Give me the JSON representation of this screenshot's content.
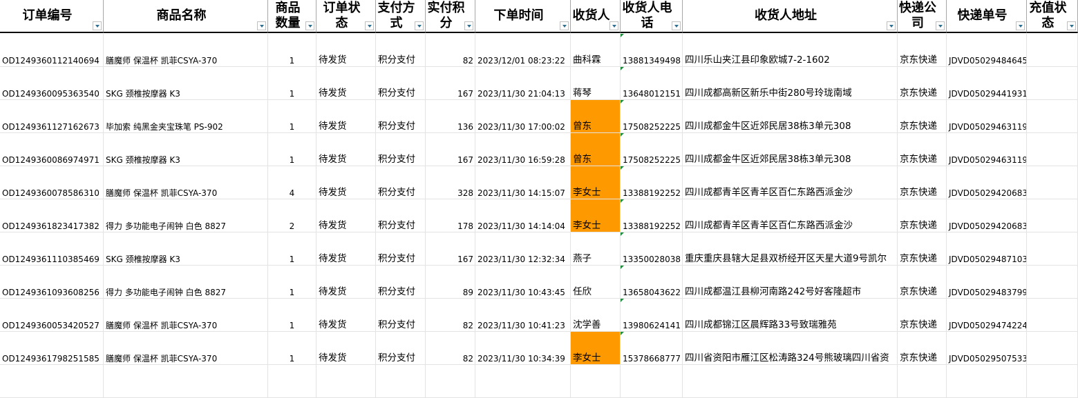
{
  "headers": [
    "订单编号",
    "商品名称",
    "商品数量",
    "订单状态",
    "支付方式",
    "实付积分",
    "下单时间",
    "收货人",
    "收货人电话",
    "收货人地址",
    "快递公司",
    "快递单号",
    "充值状态"
  ],
  "rows": [
    {
      "order_id": "OD1249360112140694",
      "product": "膳魔师 保温杯 凯菲CSYA-370",
      "qty": "1",
      "status": "待发货",
      "pay": "积分支付",
      "points": "82",
      "time": "2023/12/01 08:23:22",
      "recipient": "曲科霖",
      "recipient_highlight": false,
      "phone": "13881349498",
      "address": "四川乐山夹江县印象欧城7-2-1602",
      "courier": "京东快递",
      "tracking": "JDVD05029484645",
      "recharge": ""
    },
    {
      "order_id": "OD1249360095363540",
      "product": "SKG 颈椎按摩器 K3",
      "qty": "1",
      "status": "待发货",
      "pay": "积分支付",
      "points": "167",
      "time": "2023/11/30 21:04:13",
      "recipient": "蒋琴",
      "recipient_highlight": false,
      "phone": "13648012151",
      "address": "四川成都高新区新乐中街280号玲珑南域",
      "courier": "京东快递",
      "tracking": "JDVD05029441931",
      "recharge": ""
    },
    {
      "order_id": "OD1249361127162673",
      "product": "毕加索 纯黑金夹宝珠笔 PS-902",
      "qty": "1",
      "status": "待发货",
      "pay": "积分支付",
      "points": "136",
      "time": "2023/11/30 17:00:02",
      "recipient": "曾东",
      "recipient_highlight": true,
      "phone": "17508252225",
      "address": "四川成都金牛区近郊民居38栋3单元308",
      "courier": "京东快递",
      "tracking": "JDVD05029463119",
      "recharge": ""
    },
    {
      "order_id": "OD1249360086974971",
      "product": "SKG 颈椎按摩器 K3",
      "qty": "1",
      "status": "待发货",
      "pay": "积分支付",
      "points": "167",
      "time": "2023/11/30 16:59:28",
      "recipient": "曾东",
      "recipient_highlight": true,
      "phone": "17508252225",
      "address": "四川成都金牛区近郊民居38栋3单元308",
      "courier": "京东快递",
      "tracking": "JDVD05029463119",
      "recharge": ""
    },
    {
      "order_id": "OD1249360078586310",
      "product": "膳魔师 保温杯 凯菲CSYA-370",
      "qty": "4",
      "status": "待发货",
      "pay": "积分支付",
      "points": "328",
      "time": "2023/11/30 14:15:07",
      "recipient": "李女士",
      "recipient_highlight": true,
      "phone": "13388192252",
      "address": "四川成都青羊区青羊区百仁东路西派金沙",
      "courier": "京东快递",
      "tracking": "JDVD05029420683",
      "recharge": ""
    },
    {
      "order_id": "OD1249361823417382",
      "product": "得力 多功能电子闹钟 白色 8827",
      "qty": "2",
      "status": "待发货",
      "pay": "积分支付",
      "points": "178",
      "time": "2023/11/30 14:14:04",
      "recipient": "李女士",
      "recipient_highlight": true,
      "phone": "13388192252",
      "address": "四川成都青羊区青羊区百仁东路西派金沙",
      "courier": "京东快递",
      "tracking": "JDVD05029420683",
      "recharge": ""
    },
    {
      "order_id": "OD1249361110385469",
      "product": "SKG 颈椎按摩器 K3",
      "qty": "1",
      "status": "待发货",
      "pay": "积分支付",
      "points": "167",
      "time": "2023/11/30 12:32:34",
      "recipient": "燕子",
      "recipient_highlight": false,
      "phone": "13350028038",
      "address": "重庆重庆县辖大足县双桥经开区天星大道9号凯尔",
      "courier": "京东快递",
      "tracking": "JDVD05029487103",
      "recharge": ""
    },
    {
      "order_id": "OD1249361093608256",
      "product": "得力 多功能电子闹钟 白色 8827",
      "qty": "1",
      "status": "待发货",
      "pay": "积分支付",
      "points": "89",
      "time": "2023/11/30 10:43:45",
      "recipient": "任欣",
      "recipient_highlight": false,
      "phone": "13658043622",
      "address": "四川成都温江县柳河南路242号好客隆超市",
      "courier": "京东快递",
      "tracking": "JDVD05029483799",
      "recharge": ""
    },
    {
      "order_id": "OD1249360053420527",
      "product": "膳魔师 保温杯 凯菲CSYA-370",
      "qty": "1",
      "status": "待发货",
      "pay": "积分支付",
      "points": "82",
      "time": "2023/11/30 10:41:23",
      "recipient": "沈学善",
      "recipient_highlight": false,
      "phone": "13980624141",
      "address": "四川成都锦江区晨辉路33号致瑞雅苑",
      "courier": "京东快递",
      "tracking": "JDVD05029474224",
      "recharge": ""
    },
    {
      "order_id": "OD1249361798251585",
      "product": "膳魔师 保温杯 凯菲CSYA-370",
      "qty": "1",
      "status": "待发货",
      "pay": "积分支付",
      "points": "82",
      "time": "2023/11/30 10:34:39",
      "recipient": "李女士",
      "recipient_highlight": true,
      "phone": "15378668777",
      "address": "四川省资阳市雁江区松涛路324号熊玻璃四川省资",
      "courier": "京东快递",
      "tracking": "JDVD05029507533",
      "recharge": ""
    }
  ],
  "colors": {
    "highlight": "#ff9900",
    "comment_marker": "#1f8f3f",
    "header_border": "#000000"
  },
  "icons": {
    "filter": "filter-dropdown-icon",
    "comment": "comment-indicator-icon"
  }
}
